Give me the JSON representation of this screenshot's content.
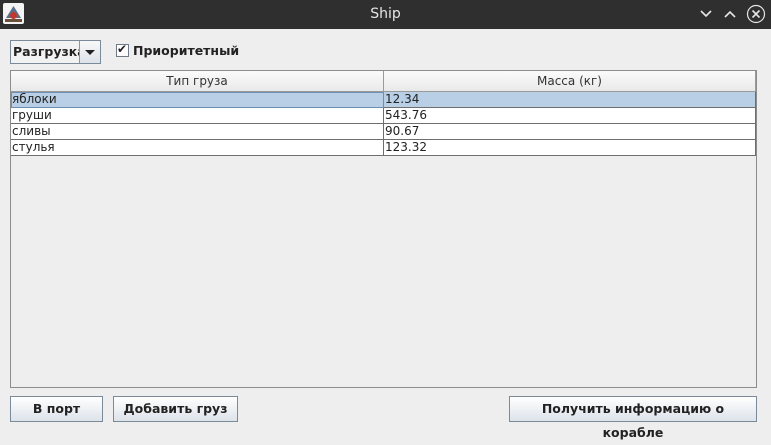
{
  "window": {
    "title": "Ship"
  },
  "toolbar": {
    "mode_select": {
      "selected": "Разгрузка"
    },
    "priority_checkbox": {
      "label": "Приоритетный",
      "checked": true,
      "mark": "✔"
    }
  },
  "table": {
    "columns": [
      "Тип груза",
      "Масса (кг)"
    ],
    "rows": [
      {
        "type": "яблоки",
        "mass": "12.34",
        "selected": true
      },
      {
        "type": "груши",
        "mass": "543.76",
        "selected": false
      },
      {
        "type": "сливы",
        "mass": "90.67",
        "selected": false
      },
      {
        "type": "стулья",
        "mass": "123.32",
        "selected": false
      }
    ]
  },
  "buttons": {
    "to_port": "В порт",
    "add_cargo": "Добавить груз",
    "ship_info": "Получить информацию о корабле"
  },
  "colors": {
    "titlebar": "#2f2f2f",
    "window_bg": "#eeeeee",
    "selection": "#b8cfe5"
  }
}
